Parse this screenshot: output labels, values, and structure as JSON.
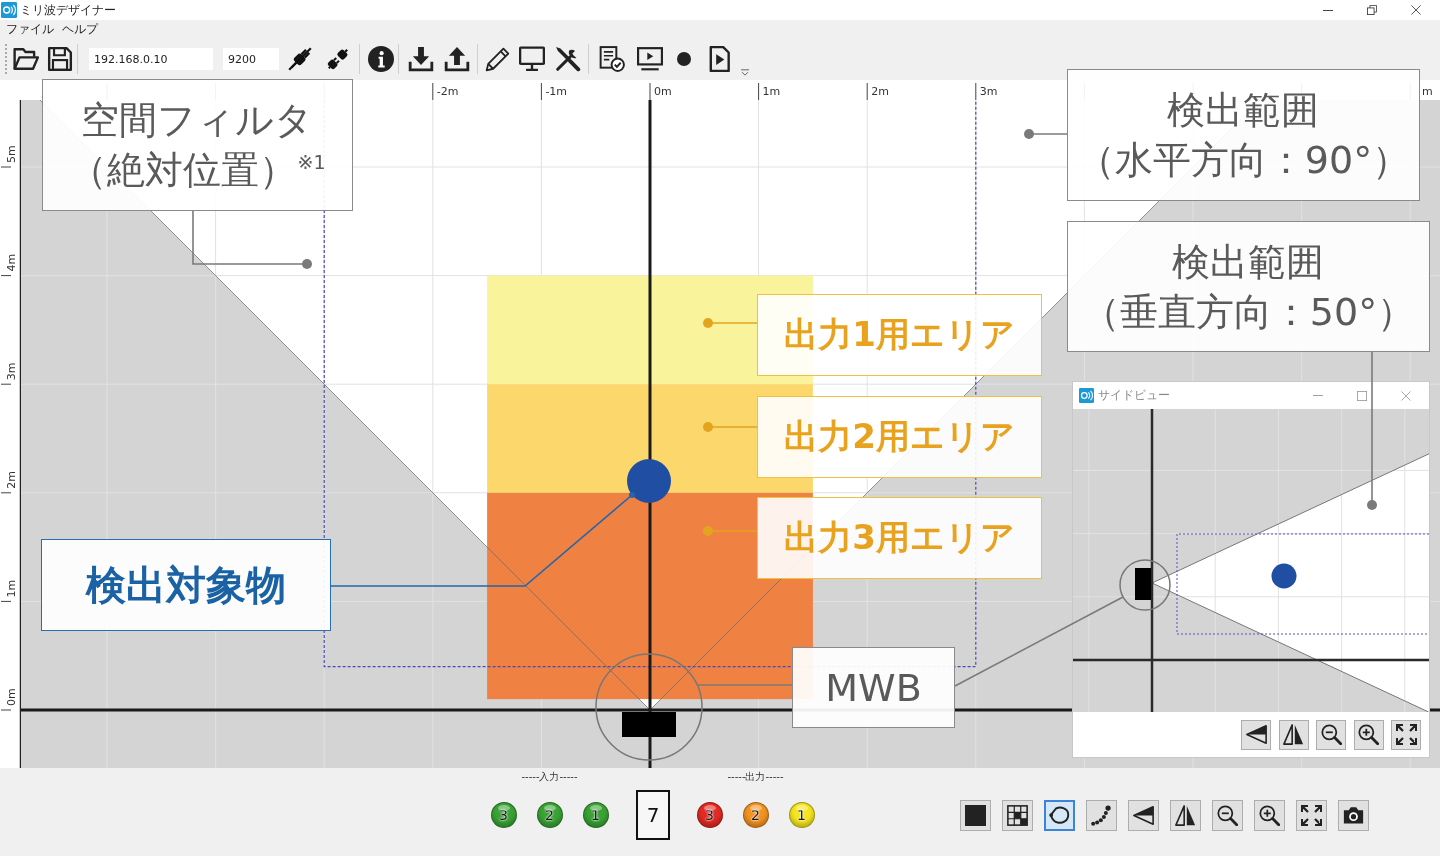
{
  "window": {
    "title": "ミリ波デザイナー"
  },
  "menu": [
    {
      "label": "ファイル"
    },
    {
      "label": "ヘルプ"
    }
  ],
  "toolbar": {
    "ip_address": "192.168.0.10",
    "port": "9200"
  },
  "top_ruler": {
    "labels": [
      "-2m",
      "-1m",
      "0m",
      "1m",
      "2m",
      "3m",
      "m"
    ]
  },
  "side_ruler": {
    "labels": [
      "5m",
      "4m",
      "3m",
      "2m",
      "1m",
      "0m"
    ]
  },
  "output_areas": [
    {
      "color": "#f9f39c"
    },
    {
      "color": "#fcd86c"
    },
    {
      "color": "#ef8142"
    }
  ],
  "callouts": [
    {
      "kind": "note",
      "lines": [
        "空間フィルタ",
        "（絶対位置）$^{※1}$"
      ]
    },
    {
      "kind": "note",
      "lines": [
        "検出範囲",
        "（水平方向：90°）"
      ]
    },
    {
      "kind": "note",
      "lines": [
        "検出範囲",
        "（垂直方向：50°）"
      ]
    },
    {
      "kind": "area",
      "lines": [
        "出力1用エリア"
      ]
    },
    {
      "kind": "area",
      "lines": [
        "出力2用エリア"
      ]
    },
    {
      "kind": "area",
      "lines": [
        "出力3用エリア"
      ]
    },
    {
      "kind": "target",
      "lines": [
        "検出対象物"
      ]
    },
    {
      "kind": "note",
      "lines": [
        "MWB"
      ]
    }
  ],
  "side_view": {
    "title": "サイドビュー"
  },
  "io": {
    "input_label": "-----入力-----",
    "inputs": [
      {
        "label": "3",
        "color": "#3aa335"
      },
      {
        "label": "2",
        "color": "#3aa335"
      },
      {
        "label": "1",
        "color": "#3aa335"
      }
    ],
    "value": "7",
    "output_label": "-----出力-----",
    "outputs": [
      {
        "label": "3",
        "color": "#e42a24"
      },
      {
        "label": "2",
        "color": "#f39322"
      },
      {
        "label": "1",
        "color": "#f6e51e"
      }
    ]
  },
  "view_tools": [
    {
      "kind": "stop",
      "selected": false
    },
    {
      "kind": "grid",
      "selected": false
    },
    {
      "kind": "lasso",
      "selected": true
    },
    {
      "kind": "trail",
      "selected": false
    },
    {
      "kind": "wedge",
      "selected": false
    },
    {
      "kind": "mirror",
      "selected": false
    },
    {
      "kind": "zoom_out",
      "selected": false
    },
    {
      "kind": "zoom_in",
      "selected": false
    },
    {
      "kind": "fit",
      "selected": false
    },
    {
      "kind": "camera",
      "selected": false
    }
  ]
}
